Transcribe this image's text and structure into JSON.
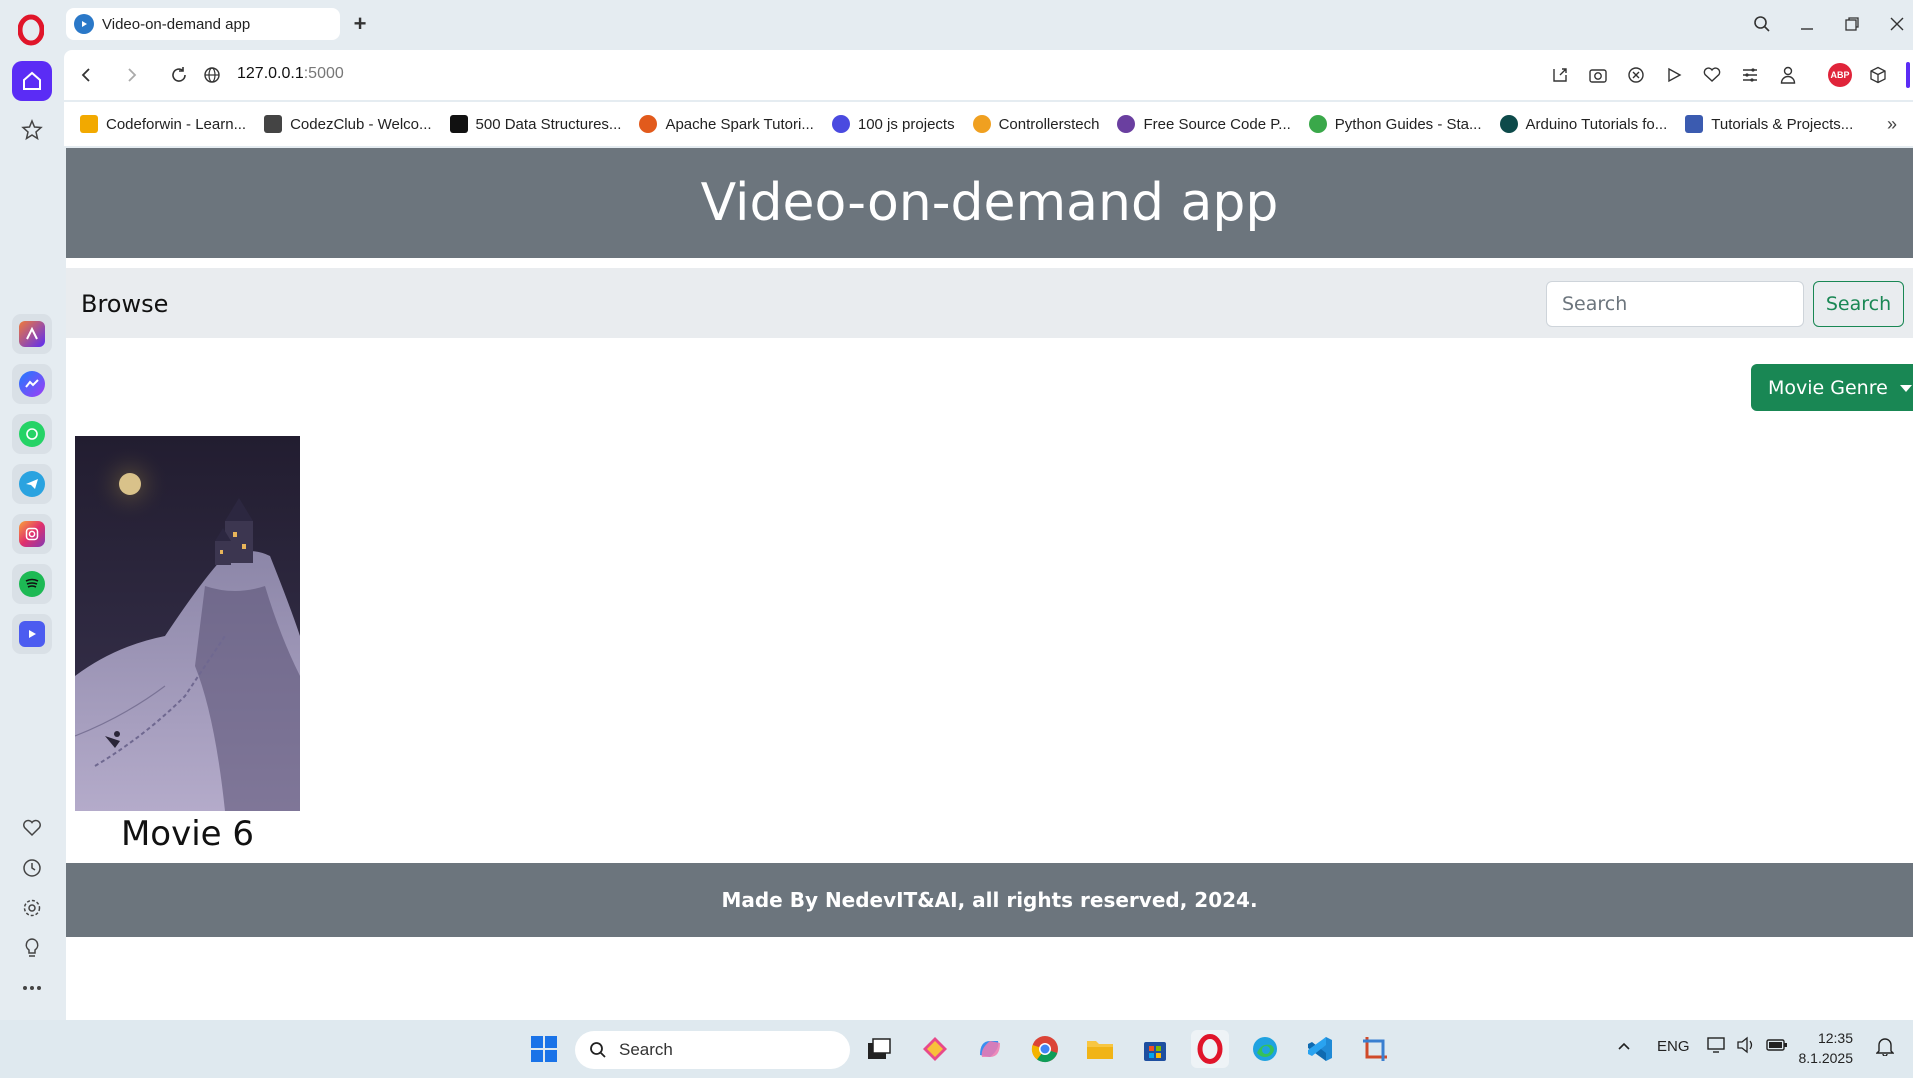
{
  "browser": {
    "tab_title": "Video-on-demand app",
    "new_tab": "+",
    "url_host": "127.0.0.1",
    "url_port": ":5000",
    "bookmarks": [
      {
        "label": "Codeforwin - Learn...",
        "color": "#f2a900"
      },
      {
        "label": "CodezClub - Welco...",
        "color": "#444444"
      },
      {
        "label": "500 Data Structures...",
        "color": "#111111"
      },
      {
        "label": "Apache Spark Tutori...",
        "color": "#e25a1c"
      },
      {
        "label": "100 js projects",
        "color": "#4a4ae0"
      },
      {
        "label": "Controllerstech",
        "color": "#f0a020"
      },
      {
        "label": "Free Source Code P...",
        "color": "#6a3fa0"
      },
      {
        "label": "Python Guides - Sta...",
        "color": "#3aa84a"
      },
      {
        "label": "Arduino Tutorials fo...",
        "color": "#0d4a4a"
      },
      {
        "label": "Tutorials & Projects...",
        "color": "#3b5bb0"
      }
    ],
    "more_bookmarks": "»",
    "abp_label": "ABP"
  },
  "site": {
    "header_title": "Video-on-demand app",
    "nav_brand": "Browse",
    "search_placeholder": "Search",
    "search_button": "Search",
    "genre_button": "Movie Genre",
    "movies": [
      {
        "title": "Movie 6"
      }
    ],
    "footer_text": "Made By NedevIT&AI, all rights reserved, 2024."
  },
  "taskbar": {
    "search_placeholder": "Search",
    "language": "ENG",
    "time": "12:35",
    "date": "8.1.2025"
  },
  "colors": {
    "header_bg": "#6c757d",
    "nav_bg": "#e9ecef",
    "accent_green": "#198754",
    "opera_purple": "#5b2cf5"
  }
}
